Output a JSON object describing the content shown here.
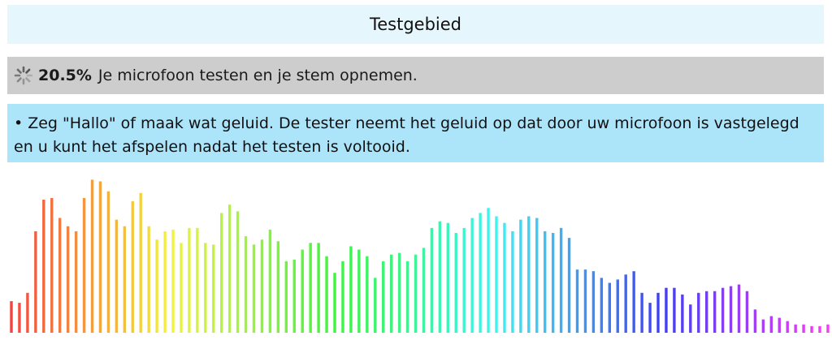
{
  "header": {
    "title": "Testgebied"
  },
  "progress": {
    "icon": "loading-spinner-icon",
    "percent_text": "20.5%",
    "percent_value": 20.5,
    "status_text": "Je microfoon testen en je stem opnemen."
  },
  "instructions": {
    "bullet": "•",
    "text": "Zeg \"Hallo\" of maak wat geluid. De tester neemt het geluid op dat door uw microfoon is vastgelegd en u kunt het afspelen nadat het testen is voltooid."
  },
  "visualizer": {
    "bar_levels": [
      0.19,
      0.18,
      0.24,
      0.61,
      0.8,
      0.81,
      0.69,
      0.64,
      0.61,
      0.81,
      0.92,
      0.91,
      0.85,
      0.68,
      0.64,
      0.79,
      0.84,
      0.64,
      0.56,
      0.61,
      0.62,
      0.54,
      0.63,
      0.63,
      0.54,
      0.53,
      0.72,
      0.77,
      0.73,
      0.58,
      0.53,
      0.56,
      0.62,
      0.55,
      0.43,
      0.44,
      0.5,
      0.54,
      0.54,
      0.46,
      0.36,
      0.43,
      0.52,
      0.5,
      0.46,
      0.33,
      0.43,
      0.47,
      0.48,
      0.43,
      0.47,
      0.51,
      0.63,
      0.67,
      0.66,
      0.6,
      0.63,
      0.69,
      0.72,
      0.75,
      0.7,
      0.66,
      0.61,
      0.68,
      0.7,
      0.69,
      0.61,
      0.6,
      0.63,
      0.57,
      0.38,
      0.38,
      0.37,
      0.33,
      0.3,
      0.32,
      0.35,
      0.37,
      0.24,
      0.18,
      0.24,
      0.27,
      0.27,
      0.23,
      0.17,
      0.24,
      0.25,
      0.25,
      0.27,
      0.28,
      0.29,
      0.25,
      0.14,
      0.08,
      0.1,
      0.09,
      0.07,
      0.05,
      0.05,
      0.04,
      0.04,
      0.05,
      0.04,
      0.05
    ]
  }
}
